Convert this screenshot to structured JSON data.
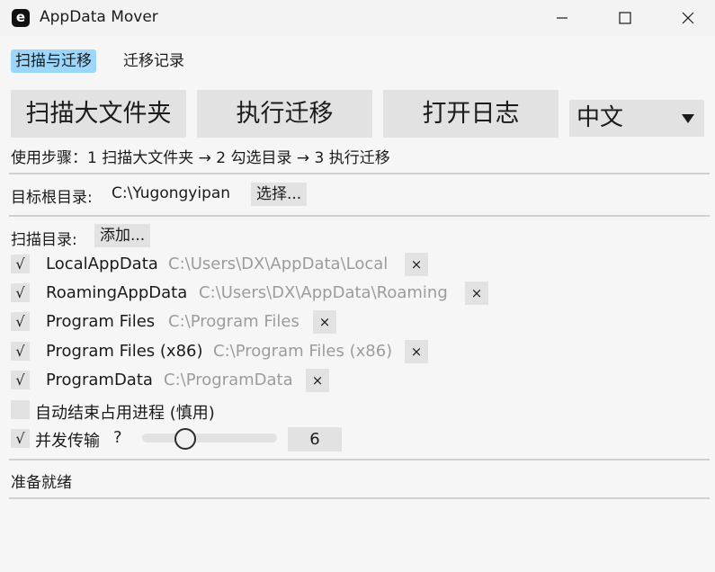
{
  "window": {
    "icon_letter": "e",
    "title": "AppData Mover"
  },
  "tabs": [
    {
      "label": "扫描与迁移",
      "active": true
    },
    {
      "label": "迁移记录",
      "active": false
    }
  ],
  "toolbar": {
    "scan_label": "扫描大文件夹",
    "migrate_label": "执行迁移",
    "open_log_label": "打开日志",
    "language_value": "中文"
  },
  "steps_text": "使用步骤：1 扫描大文件夹 → 2 勾选目录 → 3 执行迁移",
  "target": {
    "label": "目标根目录:",
    "path": "C:\\Yugongyipan",
    "choose_label": "选择..."
  },
  "scan_dirs": {
    "label": "扫描目录:",
    "add_label": "添加...",
    "items": [
      {
        "name": "LocalAppData",
        "path": "C:\\Users\\DX\\AppData\\Local",
        "checked": true
      },
      {
        "name": "RoamingAppData",
        "path": "C:\\Users\\DX\\AppData\\Roaming",
        "checked": true
      },
      {
        "name": "Program Files",
        "path": "C:\\Program Files",
        "checked": true
      },
      {
        "name": "Program Files (x86)",
        "path": "C:\\Program Files (x86)",
        "checked": true
      },
      {
        "name": "ProgramData",
        "path": "C:\\ProgramData",
        "checked": true
      }
    ],
    "check_mark": "√",
    "remove_mark": "×"
  },
  "options": {
    "auto_kill_label": "自动结束占用进程 (慎用)",
    "auto_kill_checked": false,
    "concurrent_label": "并发传输",
    "concurrent_checked": true,
    "help_mark": "?",
    "concurrency_value": "6",
    "concurrency_slider_fraction": 0.32
  },
  "status_text": "准备就绪"
}
